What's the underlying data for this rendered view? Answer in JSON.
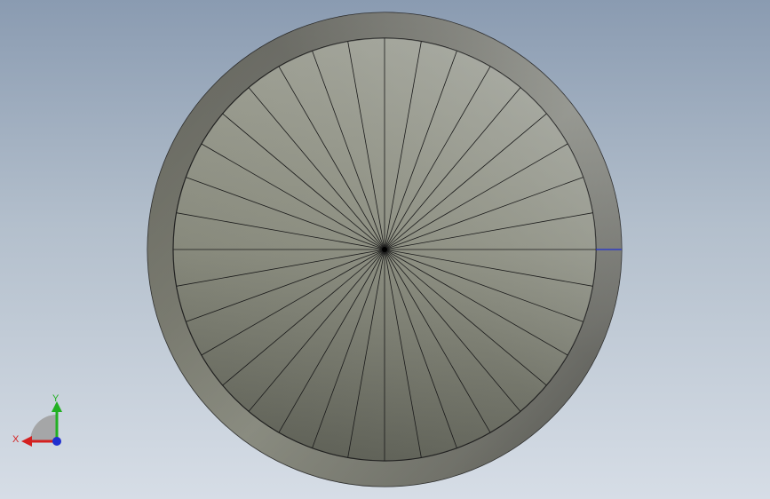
{
  "viewport": {
    "model": {
      "spoke_count": 36
    },
    "triad": {
      "x_label": "X",
      "y_label": "Y",
      "x_color": "#d42020",
      "y_color": "#22b022",
      "z_color": "#2030d0"
    }
  }
}
